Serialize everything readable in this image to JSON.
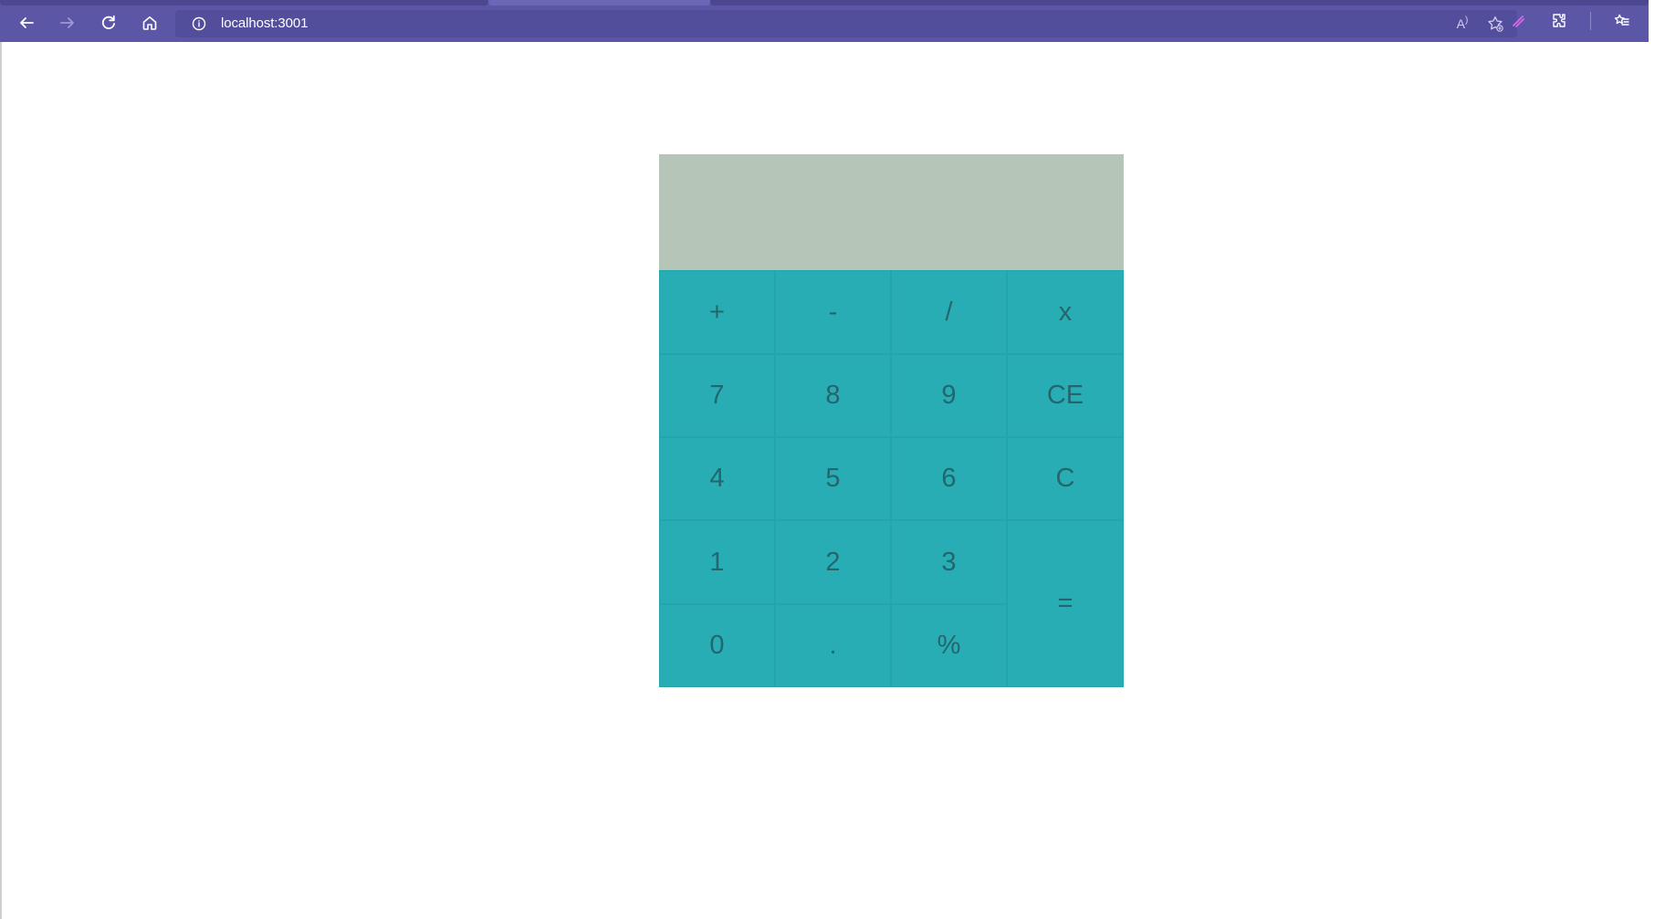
{
  "browser": {
    "address": "localhost:3001",
    "read_aloud_label": "A",
    "tabs": [
      "",
      "",
      ""
    ]
  },
  "calculator": {
    "display_value": "",
    "keys": {
      "plus": "+",
      "minus": "-",
      "divide": "/",
      "multiply": "x",
      "seven": "7",
      "eight": "8",
      "nine": "9",
      "clear_entry": "CE",
      "four": "4",
      "five": "5",
      "six": "6",
      "clear": "C",
      "one": "1",
      "two": "2",
      "three": "3",
      "equals": "=",
      "zero": "0",
      "decimal": ".",
      "percent": "%"
    }
  },
  "colors": {
    "browser_bar": "#5b57a6",
    "address_bar": "#524e9b",
    "display_background": "#b5c6b8",
    "keypad_background": "#28adb5",
    "key_text": "#24666d"
  },
  "icons": {
    "back": "back-arrow-icon",
    "forward": "forward-arrow-icon",
    "reload": "reload-icon",
    "home": "home-icon",
    "site_info": "info-icon",
    "read_aloud": "read-aloud-icon",
    "favorite_add": "favorite-add-icon",
    "copilot": "copilot-icon",
    "extensions": "extensions-icon",
    "favorites": "favorites-icon"
  }
}
